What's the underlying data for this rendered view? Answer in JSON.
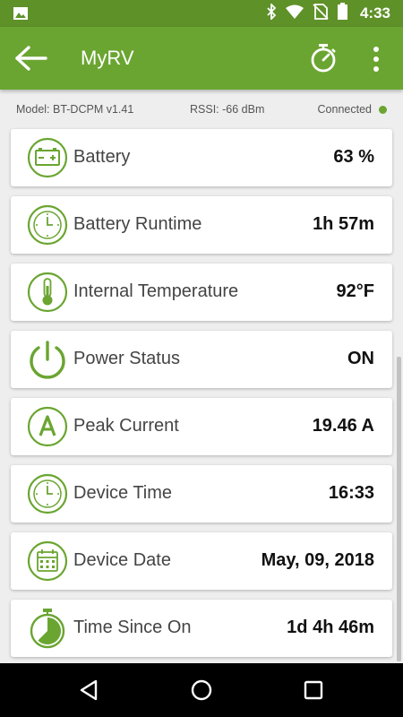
{
  "status_bar": {
    "time": "4:33"
  },
  "app_bar": {
    "title": "MyRV"
  },
  "info": {
    "model": "Model: BT-DCPM v1.41",
    "rssi": "RSSI: -66 dBm",
    "connection": "Connected"
  },
  "cards": [
    {
      "label": "Battery",
      "value": "63 %",
      "icon": "battery-icon"
    },
    {
      "label": "Battery Runtime",
      "value": "1h 57m",
      "icon": "clock-icon"
    },
    {
      "label": "Internal Temperature",
      "value": "92°F",
      "icon": "thermometer-icon"
    },
    {
      "label": "Power Status",
      "value": "ON",
      "icon": "power-icon"
    },
    {
      "label": "Peak Current",
      "value": "19.46 A",
      "icon": "ampere-icon"
    },
    {
      "label": "Device Time",
      "value": "16:33",
      "icon": "clock-icon"
    },
    {
      "label": "Device Date",
      "value": "May, 09, 2018",
      "icon": "calendar-icon"
    },
    {
      "label": "Time Since On",
      "value": "1d 4h 46m",
      "icon": "stopwatch-icon"
    }
  ],
  "colors": {
    "accent": "#6aa531",
    "status_bar": "#5f9129",
    "background": "#eeeeee",
    "connected_dot": "#6aa531"
  }
}
